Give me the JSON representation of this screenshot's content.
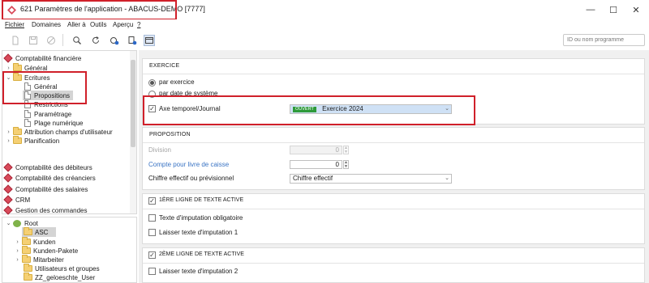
{
  "window": {
    "title": "621 Paramètres de l'application - ABACUS-DEMO [7777]",
    "buttons": {
      "minimize": "—",
      "maximize": "☐",
      "close": "✕"
    }
  },
  "menu": [
    {
      "label": "Fichier",
      "underline": "F"
    },
    {
      "label": "Domaines"
    },
    {
      "label": "Aller à"
    },
    {
      "label": "Outils"
    },
    {
      "label": "Aperçu"
    },
    {
      "label": "?"
    }
  ],
  "toolbar": {
    "icons": [
      "new-document-icon",
      "save-icon",
      "cancel-icon",
      "search-icon",
      "refresh-icon",
      "settings-icon",
      "info-icon",
      "window-icon"
    ],
    "search_placeholder": "ID ou nom programme"
  },
  "tree": {
    "modules_top": [
      {
        "label": "Comptabilité financière"
      }
    ],
    "items": [
      {
        "label": "Général",
        "type": "folder"
      },
      {
        "label": "Ecritures",
        "type": "folder",
        "expanded": true
      },
      {
        "label": "Général",
        "type": "doc"
      },
      {
        "label": "Propositions",
        "type": "doc",
        "selected": true
      },
      {
        "label": "Restrictions",
        "type": "doc"
      },
      {
        "label": "Paramétrage",
        "type": "doc"
      },
      {
        "label": "Plage numérique",
        "type": "doc"
      },
      {
        "label": "Attribution champs d'utilisateur",
        "type": "folder"
      },
      {
        "label": "Planification",
        "type": "folder"
      }
    ],
    "modules_bottom": [
      {
        "label": "Comptabilité des débiteurs"
      },
      {
        "label": "Comptabilité des créanciers"
      },
      {
        "label": "Comptabilité des salaires"
      },
      {
        "label": "CRM"
      },
      {
        "label": "Gestion des commandes"
      }
    ]
  },
  "tree2": {
    "root": "Root",
    "items": [
      {
        "label": "ASC",
        "selected": true
      },
      {
        "label": "Kunden"
      },
      {
        "label": "Kunden-Pakete"
      },
      {
        "label": "Mitarbeiter"
      },
      {
        "label": "Utilisateurs et groupes"
      },
      {
        "label": "ZZ_geloeschte_User"
      }
    ]
  },
  "exercice": {
    "header": "EXERCICE",
    "radio1": "par exercice",
    "radio2": "par date de système",
    "checkbox_label": "Axe temporel/Journal",
    "badge": "OUVERT",
    "badge_color": "#2e9a3a",
    "value": "Exercice 2024"
  },
  "proposition": {
    "header": "PROPOSITION",
    "division_label": "Division",
    "division_value": "0",
    "compte_label": "Compte pour livre de caisse",
    "compte_value": "0",
    "chiffre_label": "Chiffre effectif ou prévisionnel",
    "chiffre_value": "Chiffre effectif"
  },
  "ligne1": {
    "header": "1ÈRE LIGNE DE TEXTE ACTIVE",
    "cb1": "Texte d'imputation obligatoire",
    "cb2": "Laisser texte d'imputation 1"
  },
  "ligne2": {
    "header": "2ÈME LIGNE DE TEXTE ACTIVE",
    "cb1": "Laisser texte d'imputation 2"
  }
}
